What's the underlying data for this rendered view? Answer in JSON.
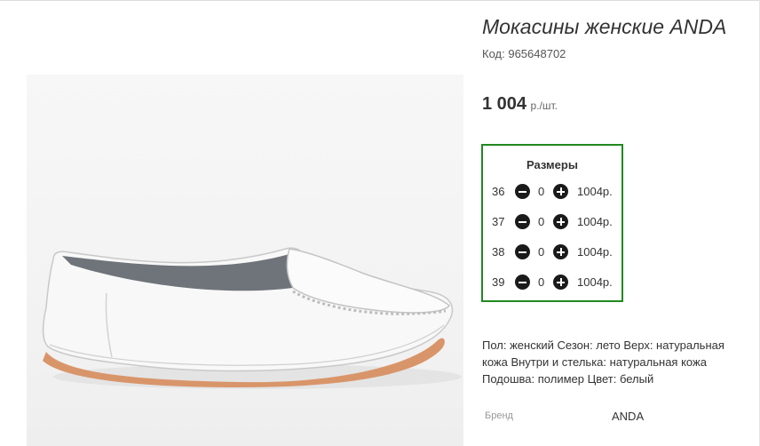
{
  "product": {
    "title": "Мокасины женские ANDA",
    "code_label": "Код:",
    "code_value": "965648702",
    "price_amount": "1 004",
    "price_unit": "р./шт."
  },
  "sizes_panel": {
    "title": "Размеры",
    "rows": [
      {
        "size": "36",
        "qty": "0",
        "price": "1004р."
      },
      {
        "size": "37",
        "qty": "0",
        "price": "1004р."
      },
      {
        "size": "38",
        "qty": "0",
        "price": "1004р."
      },
      {
        "size": "39",
        "qty": "0",
        "price": "1004р."
      }
    ]
  },
  "description": "Пол: женский Сезон: лето Верх: натуральная кожа Внутри и стелька: натуральная кожа Подошва: полимер Цвет: белый",
  "brand": {
    "label": "Бренд",
    "value": "ANDA"
  },
  "colors": {
    "accent_border": "#1e8a1e",
    "button": "#1a1a1a"
  }
}
